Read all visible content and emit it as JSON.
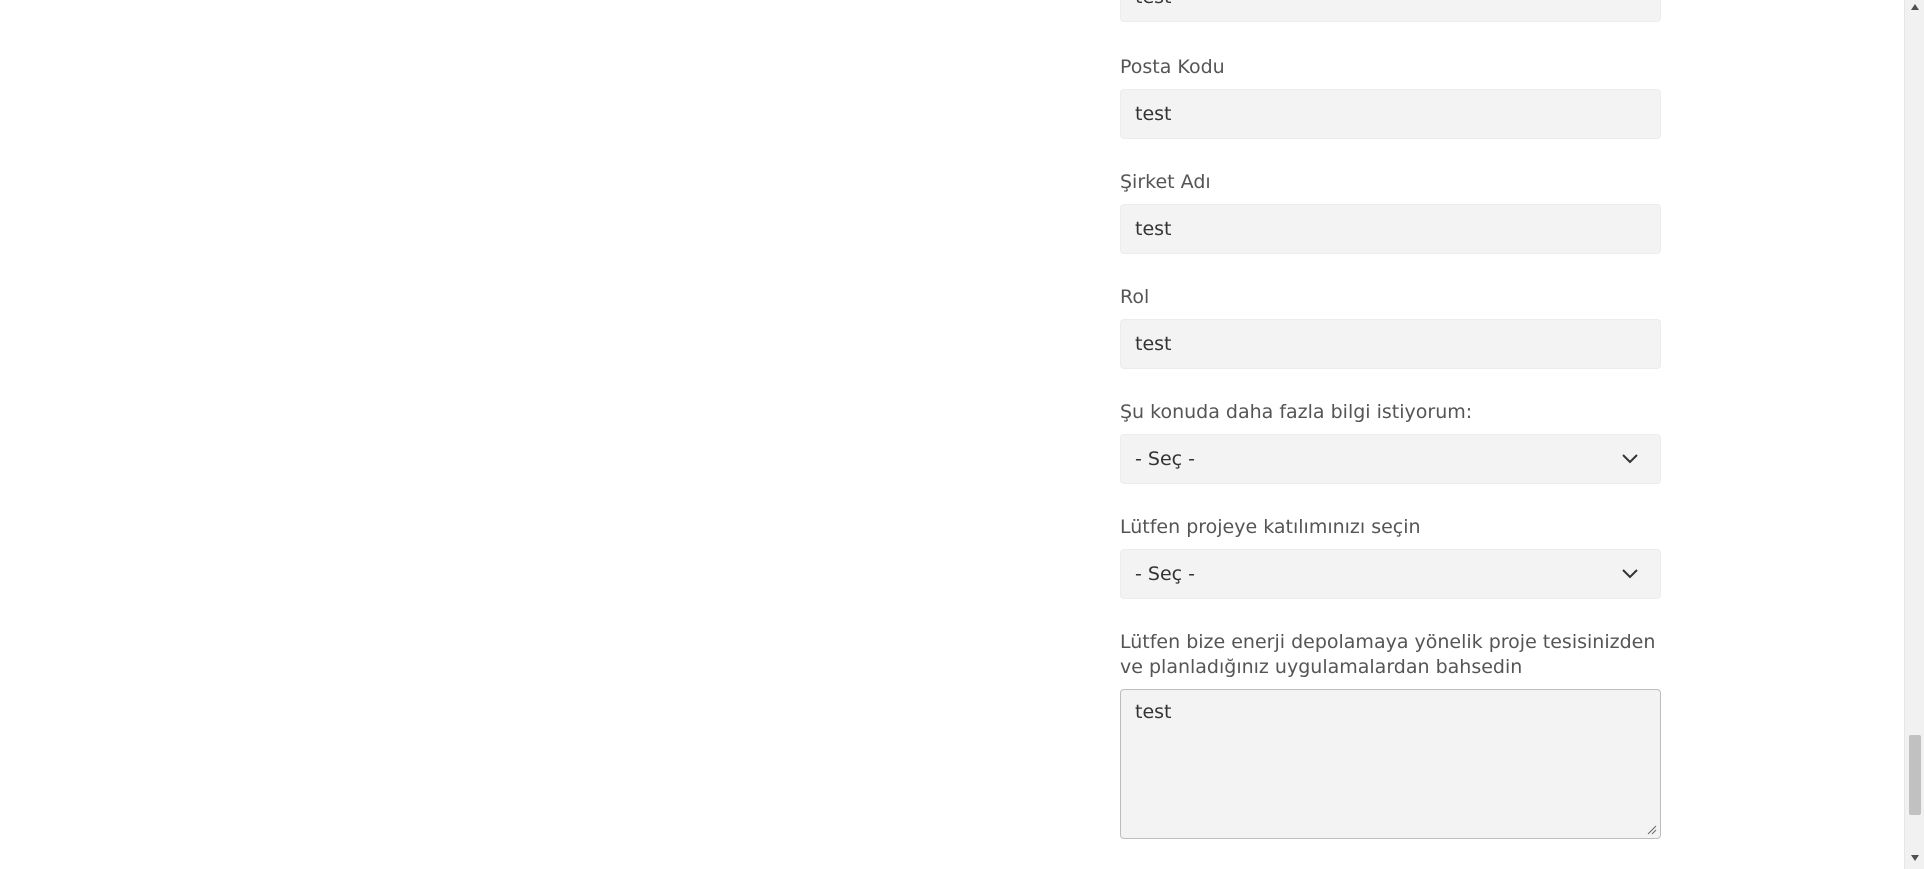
{
  "form": {
    "partial_top_field": {
      "value": "test"
    },
    "postal_code": {
      "label": "Posta Kodu",
      "value": "test"
    },
    "company_name": {
      "label": "Şirket Adı",
      "value": "test"
    },
    "role": {
      "label": "Rol",
      "value": "test"
    },
    "interest": {
      "label": "Şu konuda daha fazla bilgi istiyorum:",
      "selected": "- Seç -"
    },
    "project_involvement": {
      "label": "Lütfen projeye katılımınızı seçin",
      "selected": "- Seç -"
    },
    "project_description": {
      "label_line1": "Lütfen bize enerji depolamaya yönelik proje tesisinizden",
      "label_line2": "ve planladığınız uygulamalardan bahsedin",
      "value": "test"
    }
  },
  "icons": {
    "select_chevron": "chevron-down-icon",
    "scroll_up": "scroll-up-arrow-icon",
    "scroll_down": "scroll-down-arrow-icon",
    "resize": "resize-grip-icon"
  }
}
